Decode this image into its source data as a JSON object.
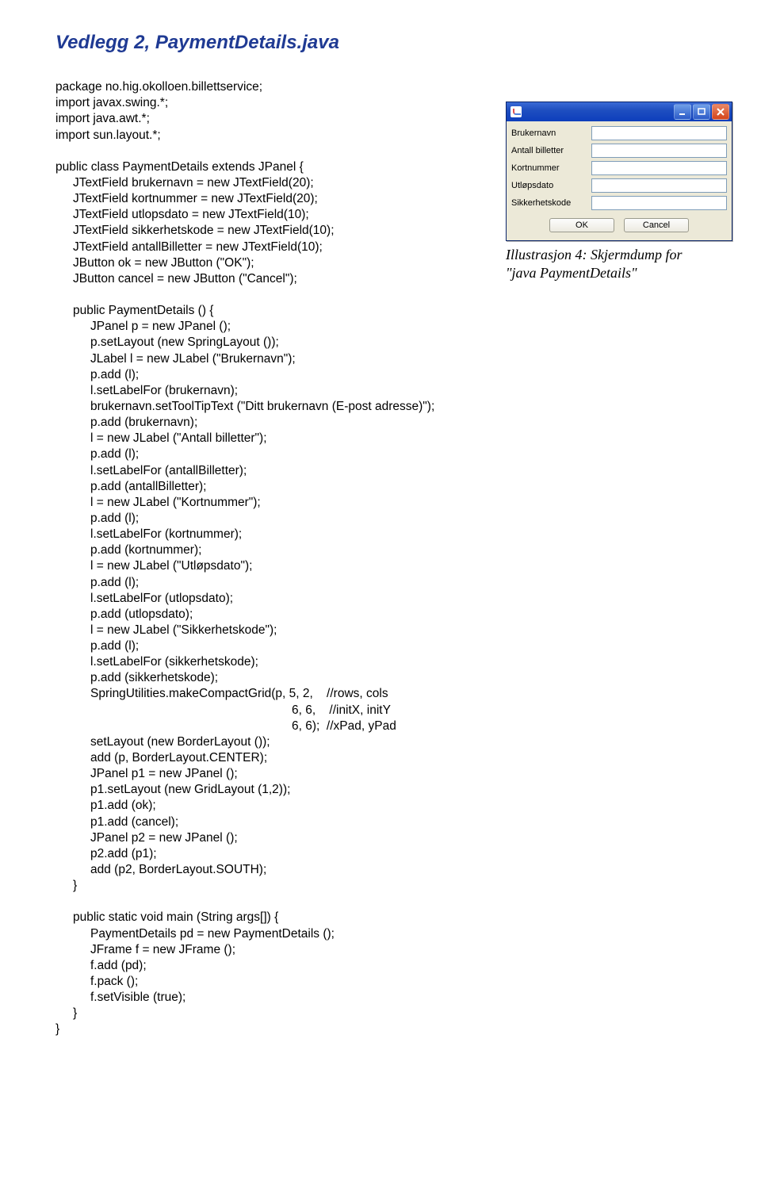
{
  "title": "Vedlegg 2, PaymentDetails.java",
  "code": {
    "l01": "package no.hig.okolloen.billettservice;",
    "l02": "import javax.swing.*;",
    "l03": "import java.awt.*;",
    "l04": "import sun.layout.*;",
    "l05": "",
    "l06": "public class PaymentDetails extends JPanel {",
    "l07": "JTextField brukernavn = new JTextField(20);",
    "l08": "JTextField kortnummer = new JTextField(20);",
    "l09": "JTextField utlopsdato = new JTextField(10);",
    "l10": "JTextField sikkerhetskode = new JTextField(10);",
    "l11": "JTextField antallBilletter = new JTextField(10);",
    "l12": "JButton ok = new JButton (\"OK\");",
    "l13": "JButton cancel = new JButton (\"Cancel\");",
    "l14": "",
    "l15": "public PaymentDetails () {",
    "l16": "JPanel p = new JPanel ();",
    "l17": "p.setLayout (new SpringLayout ());",
    "l18": "JLabel l = new JLabel (\"Brukernavn\");",
    "l19": "p.add (l);",
    "l20": "l.setLabelFor (brukernavn);",
    "l21": "brukernavn.setToolTipText (\"Ditt brukernavn (E-post adresse)\");",
    "l22": "p.add (brukernavn);",
    "l23": "l = new JLabel (\"Antall billetter\");",
    "l24": "p.add (l);",
    "l25": "l.setLabelFor (antallBilletter);",
    "l26": "p.add (antallBilletter);",
    "l27": "l = new JLabel (\"Kortnummer\");",
    "l28": "p.add (l);",
    "l29": "l.setLabelFor (kortnummer);",
    "l30": "p.add (kortnummer);",
    "l31": "l = new JLabel (\"Utløpsdato\");",
    "l32": "p.add (l);",
    "l33": "l.setLabelFor (utlopsdato);",
    "l34": "p.add (utlopsdato);",
    "l35": "l = new JLabel (\"Sikkerhetskode\");",
    "l36": "p.add (l);",
    "l37": "l.setLabelFor (sikkerhetskode);",
    "l38": "p.add (sikkerhetskode);",
    "l39": "SpringUtilities.makeCompactGrid(p, 5, 2,    //rows, cols",
    "l40": "6, 6,    //initX, initY",
    "l41": "6, 6);  //xPad, yPad",
    "l42": "setLayout (new BorderLayout ());",
    "l43": "add (p, BorderLayout.CENTER);",
    "l44": "JPanel p1 = new JPanel ();",
    "l45": "p1.setLayout (new GridLayout (1,2));",
    "l46": "p1.add (ok);",
    "l47": "p1.add (cancel);",
    "l48": "JPanel p2 = new JPanel ();",
    "l49": "p2.add (p1);",
    "l50": "add (p2, BorderLayout.SOUTH);",
    "l51": "}",
    "l52": "",
    "l53": "public static void main (String args[]) {",
    "l54": "PaymentDetails pd = new PaymentDetails ();",
    "l55": "JFrame f = new JFrame ();",
    "l56": "f.add (pd);",
    "l57": "f.pack ();",
    "l58": "f.setVisible (true);",
    "l59": "}",
    "l60": "}"
  },
  "window": {
    "fields": {
      "f1": "Brukernavn",
      "f2": "Antall billetter",
      "f3": "Kortnummer",
      "f4": "Utløpsdato",
      "f5": "Sikkerhetskode"
    },
    "buttons": {
      "ok": "OK",
      "cancel": "Cancel"
    }
  },
  "caption": {
    "line1": "Illustrasjon 4: Skjermdump for",
    "line2": "\"java PaymentDetails\""
  }
}
